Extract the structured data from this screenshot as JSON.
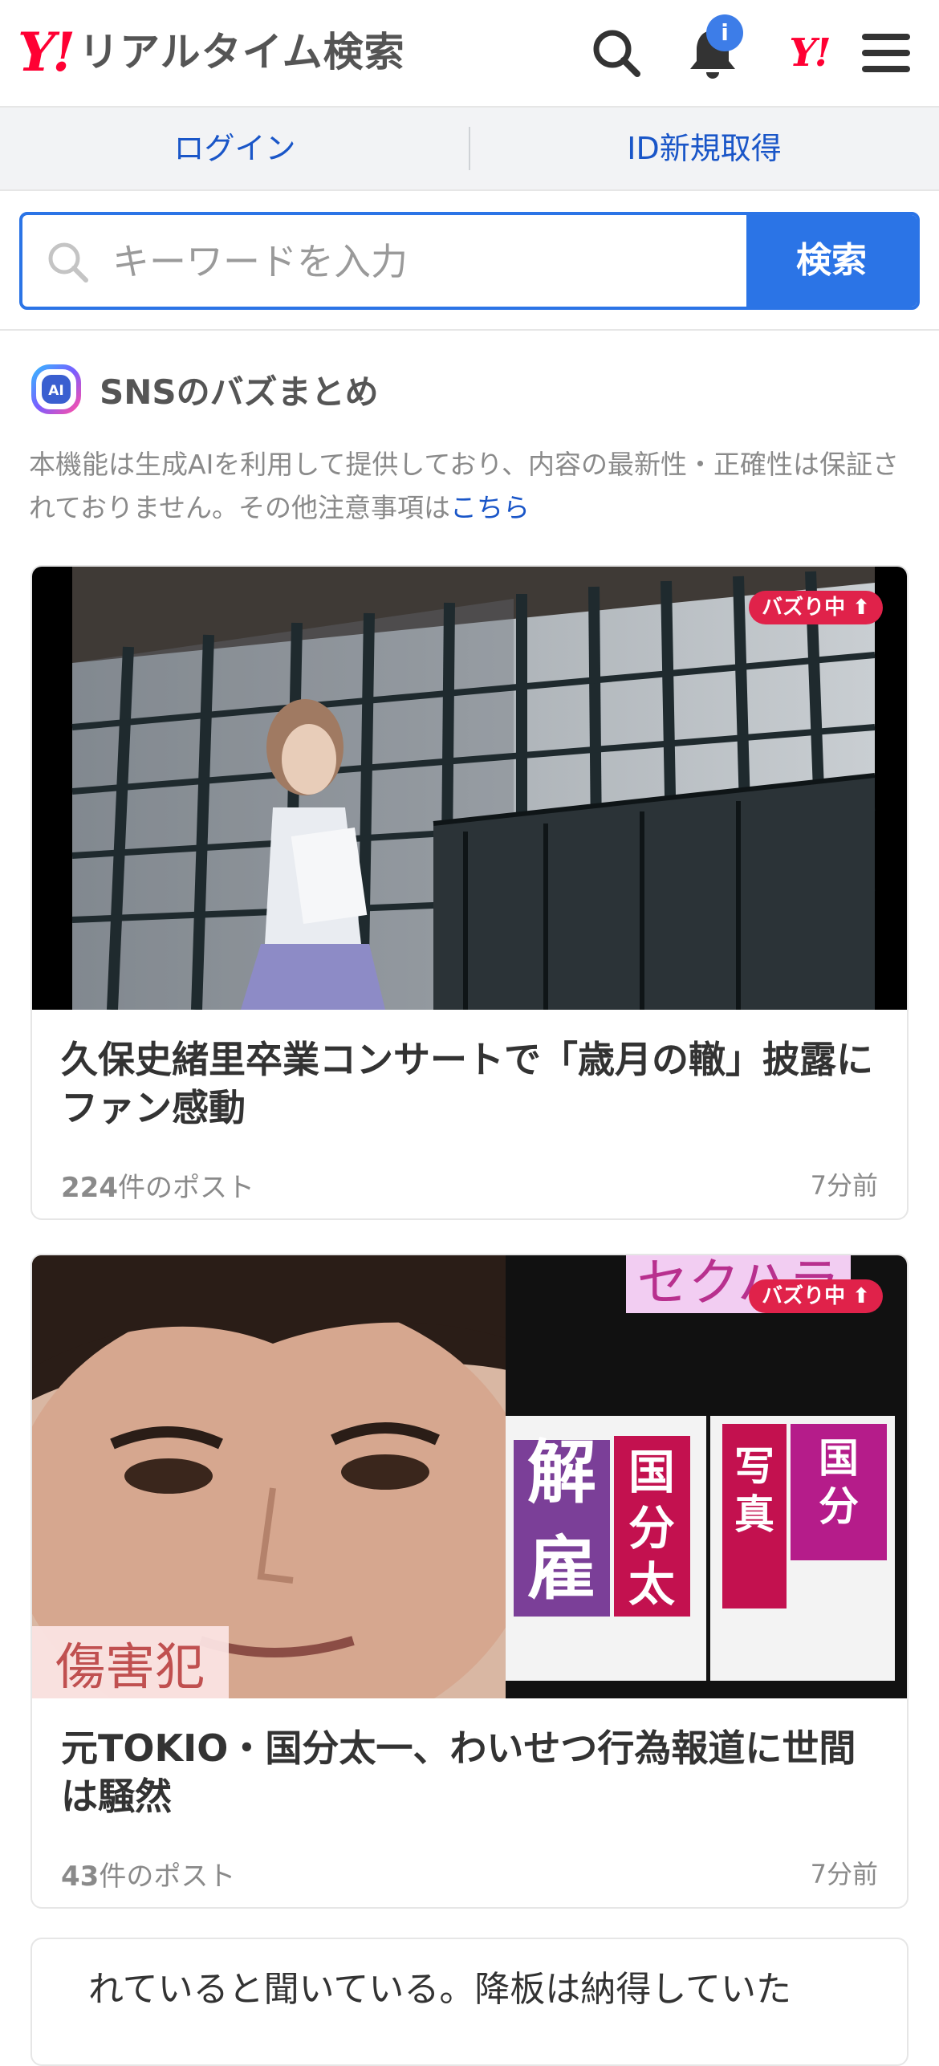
{
  "header": {
    "logo_mark": "Y!",
    "logo_text": "リアルタイム検索",
    "notification_badge": "i",
    "mini_logo": "Y!"
  },
  "auth": {
    "login_label": "ログイン",
    "register_label": "ID新規取得"
  },
  "search": {
    "placeholder": "キーワードを入力",
    "button_label": "検索"
  },
  "ai_section": {
    "badge": "AI",
    "title": "SNSのバズまとめ",
    "notice_text": "本機能は生成AIを利用して提供しており、内容の最新性・正確性は保証されておりません。その他注意事項は",
    "notice_link": "こちら"
  },
  "cards": [
    {
      "badge": "バズり中",
      "title": "久保史緒里卒業コンサートで「歳月の轍」披露にファン感動",
      "count": "224",
      "count_suffix": "件のポスト",
      "time": "7分前"
    },
    {
      "badge": "バズり中",
      "title": "元TOKIO・国分太一、わいせつ行為報道に世間は騒然",
      "count": "43",
      "count_suffix": "件のポスト",
      "time": "7分前",
      "image_overlay_text": "傷害犯",
      "image_top_text": "セクハラ"
    }
  ],
  "partial_card": {
    "text": "れていると聞いている。降板は納得していた"
  },
  "colors": {
    "accent": "#2b74e6",
    "brand_red": "#ff0033",
    "buzz_badge": "#e0224a",
    "link": "#1a56c8"
  },
  "icons": [
    "search-icon",
    "bell-icon",
    "yahoo-mini-logo",
    "menu-icon",
    "ai-icon",
    "arrow-up-icon"
  ]
}
